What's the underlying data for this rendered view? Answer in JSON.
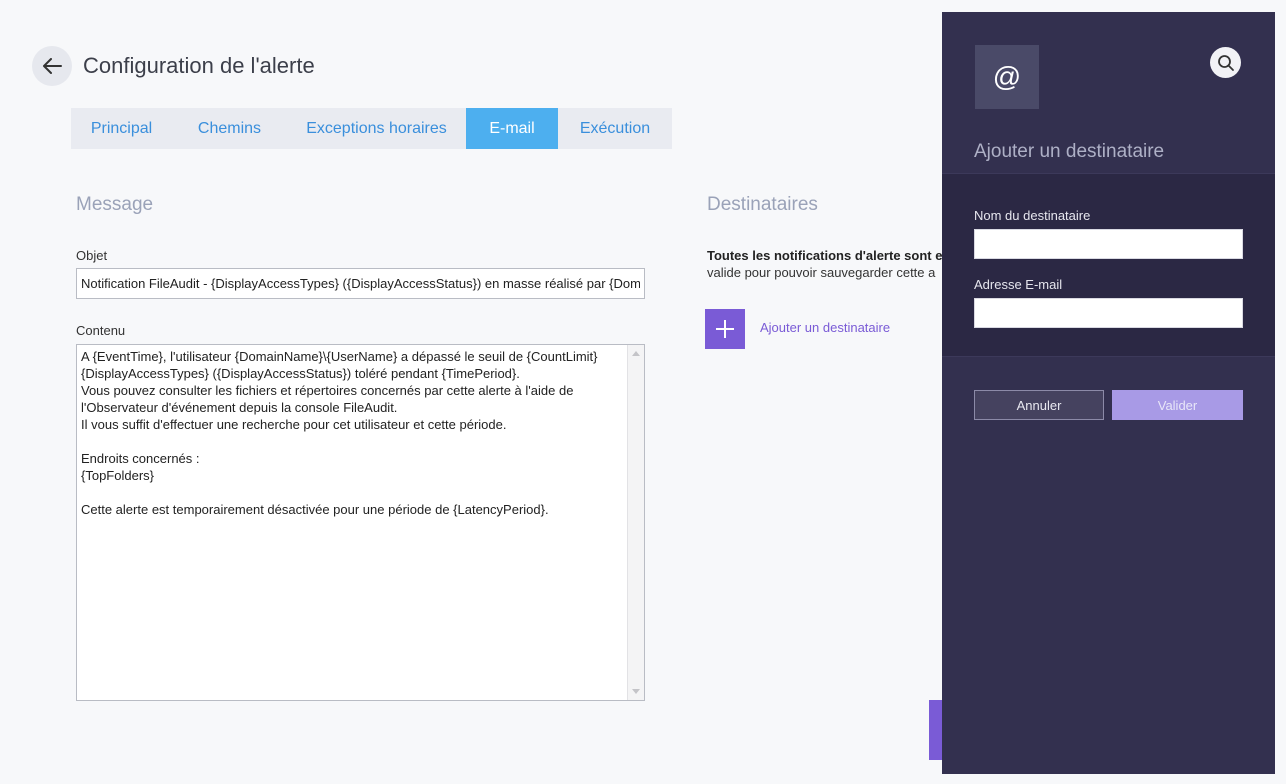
{
  "header": {
    "title": "Configuration de l'alerte",
    "back_icon": "arrow-left-icon"
  },
  "tabs": [
    {
      "label": "Principal",
      "active": false
    },
    {
      "label": "Chemins",
      "active": false
    },
    {
      "label": "Exceptions horaires",
      "active": false
    },
    {
      "label": "E-mail",
      "active": true
    },
    {
      "label": "Exécution",
      "active": false
    }
  ],
  "message": {
    "section_title": "Message",
    "subject_label": "Objet",
    "subject_value": "Notification FileAudit - {DisplayAccessTypes} ({DisplayAccessStatus}) en masse réalisé par {DomainName}\\{UserName}",
    "content_label": "Contenu",
    "content_value": "A {EventTime}, l'utilisateur {DomainName}\\{UserName} a dépassé le seuil de {CountLimit}\n{DisplayAccessTypes} ({DisplayAccessStatus}) toléré pendant {TimePeriod}.\nVous pouvez consulter les fichiers et répertoires concernés par cette alerte à l'aide de\nl'Observateur d'événement depuis la console FileAudit.\nIl vous suffit d'effectuer une recherche pour cet utilisateur et cette période.\n\nEndroits concernés :\n{TopFolders}\n\nCette alerte est temporairement désactivée pour une période de {LatencyPeriod}."
  },
  "recipients": {
    "section_title": "Destinataires",
    "notice_bold": "Toutes les notifications d'alerte sont e",
    "notice_text": "valide pour pouvoir sauvegarder cette a",
    "add_label": "Ajouter un destinataire",
    "add_icon": "plus-icon"
  },
  "panel": {
    "icon": "@",
    "title": "Ajouter un destinataire",
    "name_label": "Nom du destinataire",
    "name_value": "",
    "email_label": "Adresse E-mail",
    "email_value": "",
    "cancel_label": "Annuler",
    "validate_label": "Valider",
    "search_icon": "search-icon"
  },
  "colors": {
    "accent_tab": "#4dafef",
    "purple": "#7a5bd6",
    "panel_bg": "#33304f"
  }
}
